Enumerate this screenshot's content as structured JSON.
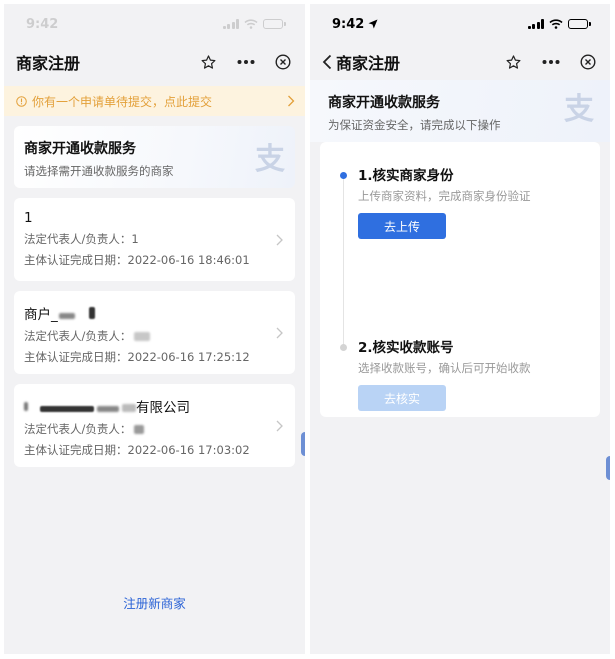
{
  "left": {
    "status": {
      "time": "9:42"
    },
    "nav": {
      "title": "商家注册"
    },
    "notice": {
      "text": "你有一个申请单待提交，点此提交"
    },
    "service": {
      "title": "商家开通收款服务",
      "subtitle": "请选择需开通收款服务的商家"
    },
    "merchants": [
      {
        "name": "1",
        "rep_label": "法定代表人/负责人：",
        "rep_value": "1",
        "date_label": "主体认证完成日期：",
        "date": "2022-06-16 18:46:01"
      },
      {
        "name": "商户_",
        "rep_label": "法定代表人/负责人：",
        "rep_value": "",
        "date_label": "主体认证完成日期：",
        "date": "2022-06-16 17:25:12"
      },
      {
        "name": "有限公司",
        "rep_label": "法定代表人/负责人：",
        "rep_value": "",
        "date_label": "主体认证完成日期：",
        "date": "2022-06-16 17:03:02"
      }
    ],
    "register_link": "注册新商家"
  },
  "right": {
    "status": {
      "time": "9:42"
    },
    "nav": {
      "title": "商家注册"
    },
    "service": {
      "title": "商家开通收款服务",
      "subtitle": "为保证资金安全，请完成以下操作"
    },
    "steps": [
      {
        "title": "1.核实商家身份",
        "desc": "上传商家资料，完成商家身份验证",
        "button": "去上传"
      },
      {
        "title": "2.核实收款账号",
        "desc": "选择收款账号，确认后可开始收款",
        "button": "去核实"
      }
    ]
  },
  "colors": {
    "accent": "#2f6fe0",
    "accent_disabled": "#b9d3f5",
    "notice_bg": "#fdf3df",
    "notice_text": "#e3a03a",
    "link": "#2b63d6"
  },
  "icons": {
    "logo": "alipay-logo-icon",
    "back": "chevron-left-icon",
    "favorite": "star-icon",
    "more": "more-dots-icon",
    "close": "close-circle-icon",
    "notice": "info-circle-icon"
  }
}
